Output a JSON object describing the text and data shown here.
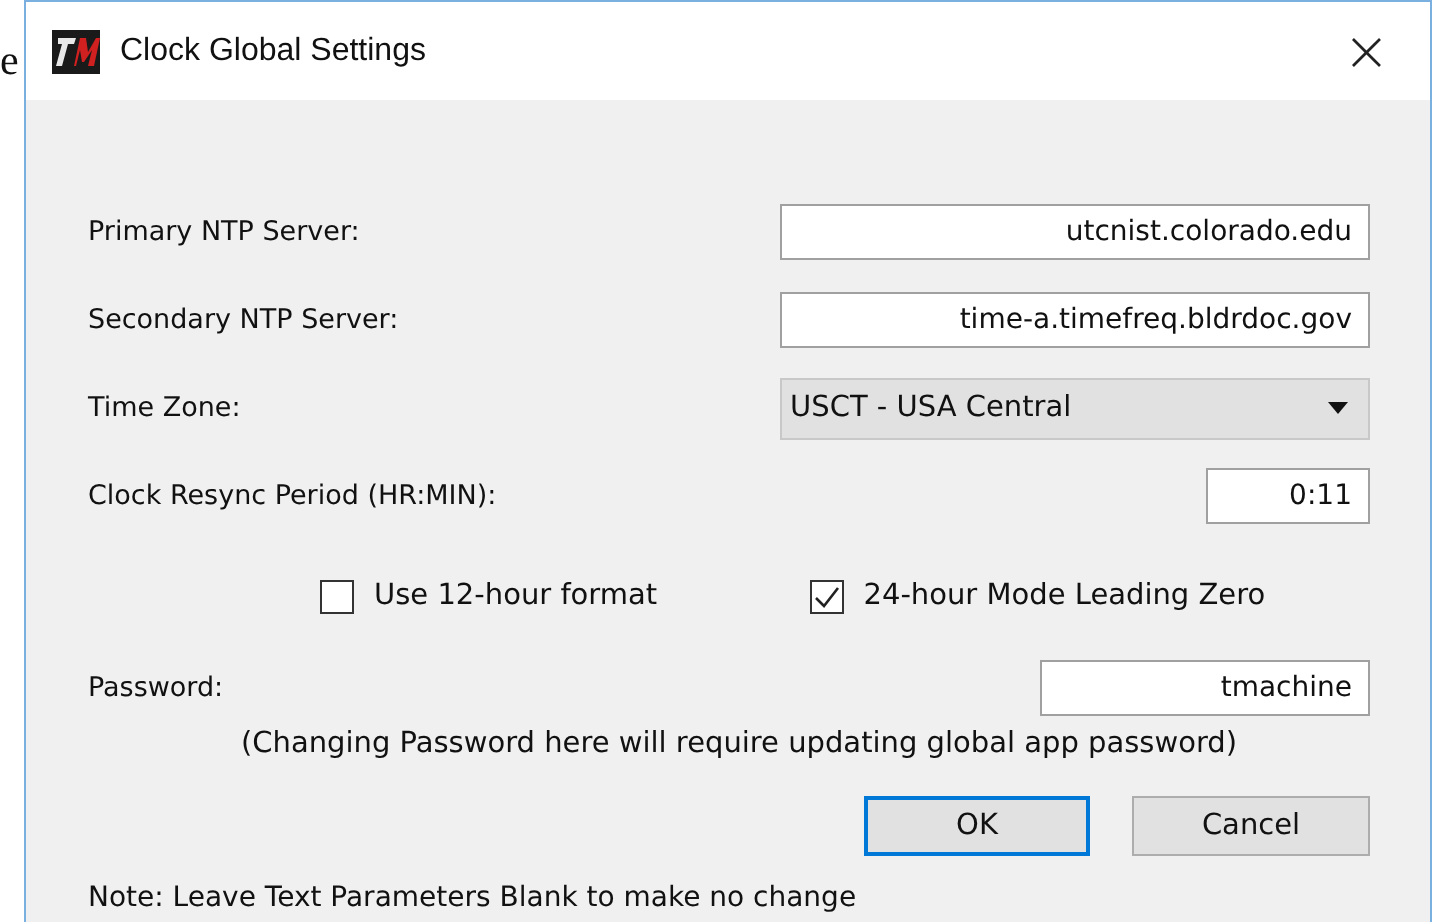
{
  "background_text": "e",
  "window": {
    "title": "Clock Global Settings",
    "close": "×"
  },
  "fields": [
    {
      "label": "Primary NTP Server:",
      "value": "utcnist.colorado.edu",
      "kind": "wide"
    },
    {
      "label": "Secondary NTP Server:",
      "value": "time-a.timefreq.bldrdoc.gov",
      "kind": "wide"
    },
    {
      "label": "Time Zone:",
      "value": "USCT - USA Central",
      "kind": "select"
    },
    {
      "label": "Clock Resync Period (HR:MIN):",
      "value": "0:11",
      "kind": "short"
    }
  ],
  "checkboxes": [
    {
      "label": "Use 12-hour format",
      "checked": false
    },
    {
      "label": "24-hour Mode Leading Zero",
      "checked": true
    }
  ],
  "password": {
    "label": "Password:",
    "value": "tmachine",
    "hint": "(Changing Password here will require updating global app password)"
  },
  "buttons": [
    {
      "label": "OK",
      "selected": true
    },
    {
      "label": "Cancel",
      "selected": false
    }
  ],
  "note": "Note: Leave Text Parameters Blank to make no change"
}
